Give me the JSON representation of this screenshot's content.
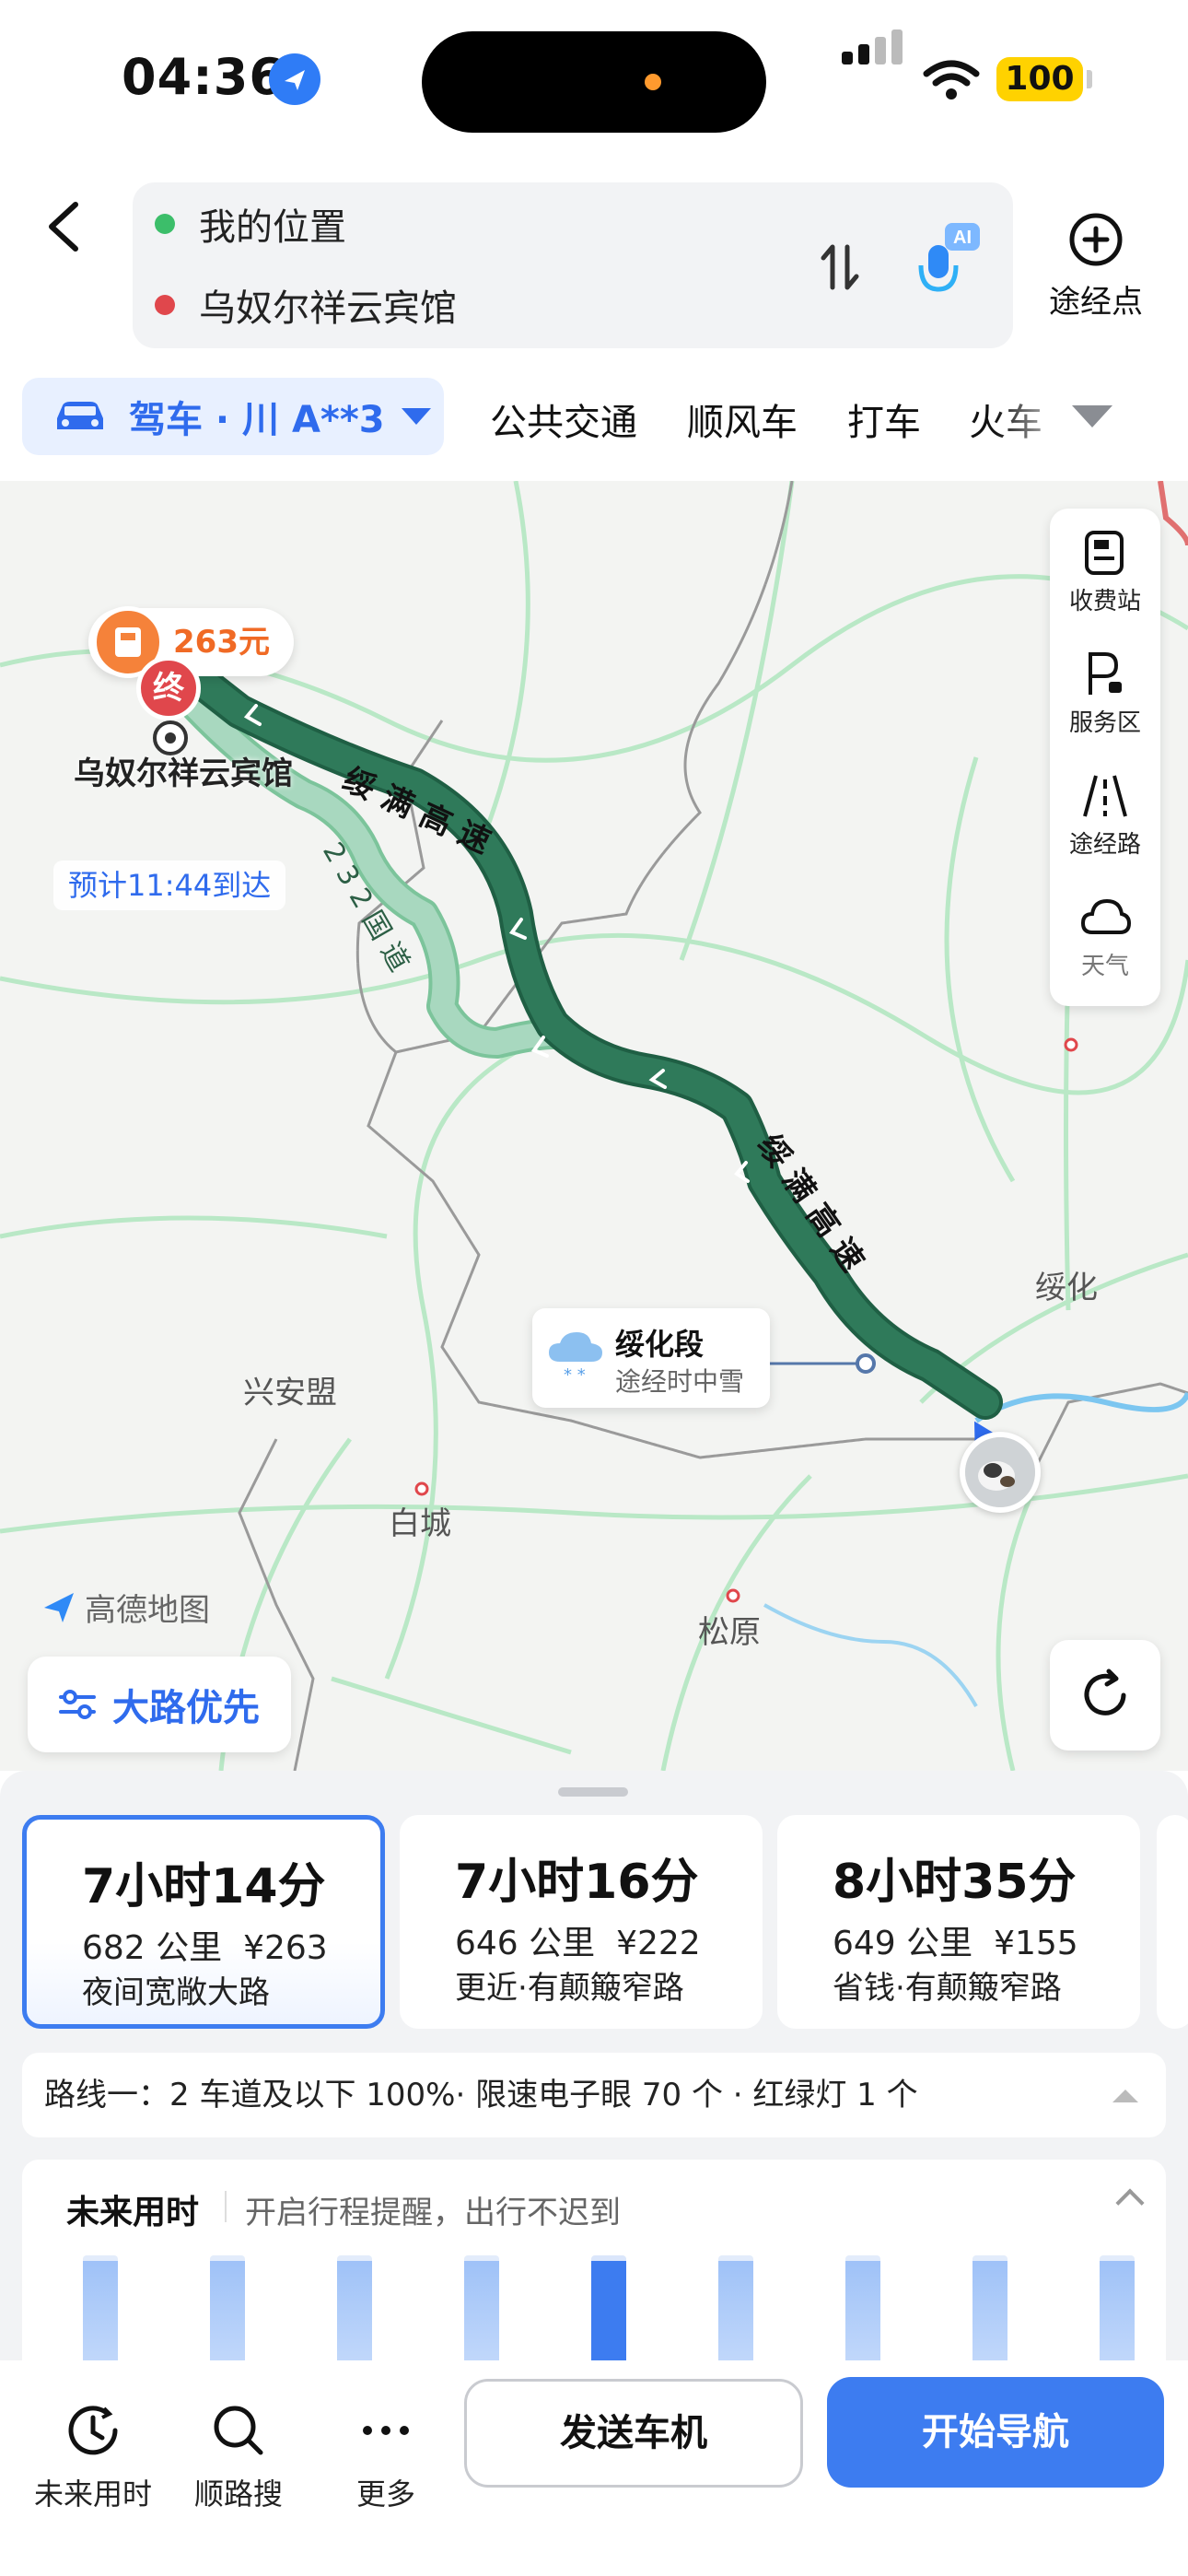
{
  "status_bar": {
    "time": "04:36",
    "battery": "100"
  },
  "route": {
    "origin": "我的位置",
    "destination": "乌奴尔祥云宾馆",
    "waypoint_label": "途经点",
    "ai_badge": "AI"
  },
  "tabs": {
    "drive": "驾车 · 川 A**3",
    "items": [
      "公共交通",
      "顺风车",
      "打车",
      "火车"
    ]
  },
  "map": {
    "toll_price": "263元",
    "end_marker": "终",
    "destination_name": "乌奴尔祥云宾馆",
    "eta": "预计11:44到达",
    "road_labels": [
      "绥 满 高 速",
      "2 3 2 国 道",
      "绥 满 高 速"
    ],
    "places": [
      "绥化",
      "兴安盟",
      "白城",
      "松原"
    ],
    "weather": {
      "title": "绥化段",
      "sub": "途经时中雪"
    },
    "logo": "高德地图",
    "road_preference": "大路优先",
    "side_tools": [
      "收费站",
      "服务区",
      "途经路",
      "天气"
    ]
  },
  "routes": [
    {
      "duration": "7小时14分",
      "distance": "682 公里",
      "price": "¥263",
      "desc": "夜间宽敞大路",
      "selected": true
    },
    {
      "duration": "7小时16分",
      "distance": "646 公里",
      "price": "¥222",
      "desc": "更近·有颠簸窄路",
      "selected": false
    },
    {
      "duration": "8小时35分",
      "distance": "649 公里",
      "price": "¥155",
      "desc": "省钱·有颠簸窄路",
      "selected": false
    }
  ],
  "route_info": "路线一：2 车道及以下 100%· 限速电子眼 70 个 · 红绿灯 1 个",
  "future": {
    "title": "未来用时",
    "subtitle": "开启行程提醒，出行不迟到",
    "bars": 9,
    "selected_index": 4
  },
  "bottom_bar": {
    "items": [
      "未来用时",
      "顺路搜",
      "更多"
    ],
    "send": "发送车机",
    "navigate": "开始导航"
  },
  "colors": {
    "accent": "#3d7cf0",
    "route_main": "#2f7a5a",
    "route_alt": "#a8d8bf",
    "toll": "#f5823a",
    "end": "#e0474c"
  }
}
